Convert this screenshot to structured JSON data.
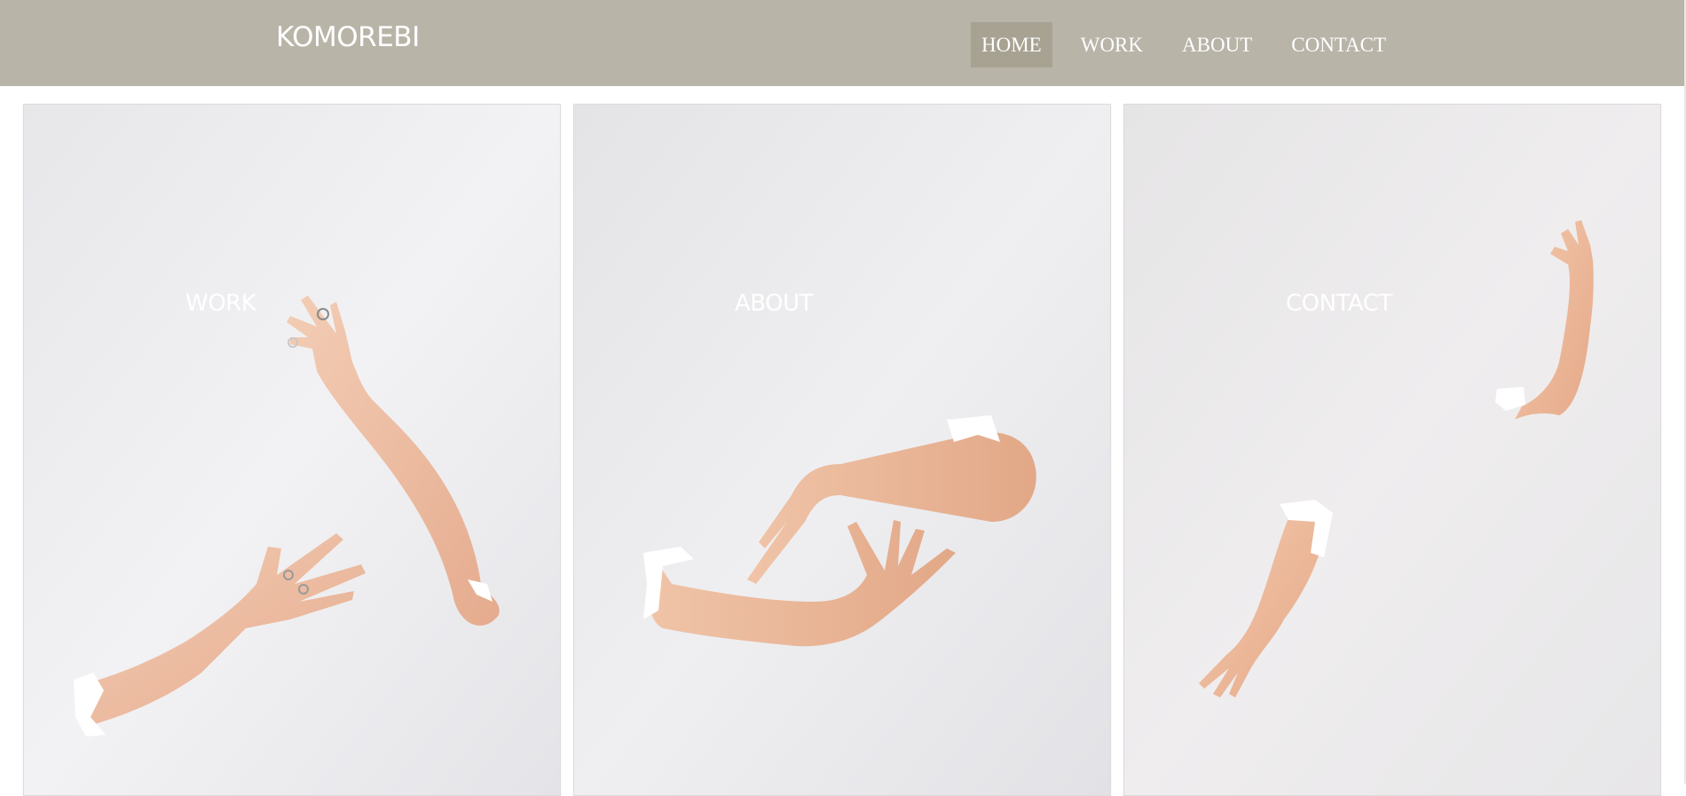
{
  "header": {
    "brand": "KOMOREBI",
    "nav": [
      {
        "label": "HOME",
        "active": true
      },
      {
        "label": "WORK",
        "active": false
      },
      {
        "label": "ABOUT",
        "active": false
      },
      {
        "label": "CONTACT",
        "active": false
      }
    ]
  },
  "cards": [
    {
      "label": "WORK",
      "image": "two-hands-reaching-from-torn-paper"
    },
    {
      "label": "ABOUT",
      "image": "crossed-arms-through-torn-paper"
    },
    {
      "label": "CONTACT",
      "image": "arms-reaching-through-torn-paper"
    }
  ],
  "colors": {
    "header_bg": "#b8b4a8",
    "nav_active_bg": "#a8a293",
    "text": "#ffffff",
    "skin": "#eec0a4",
    "paper": "#ececee"
  }
}
